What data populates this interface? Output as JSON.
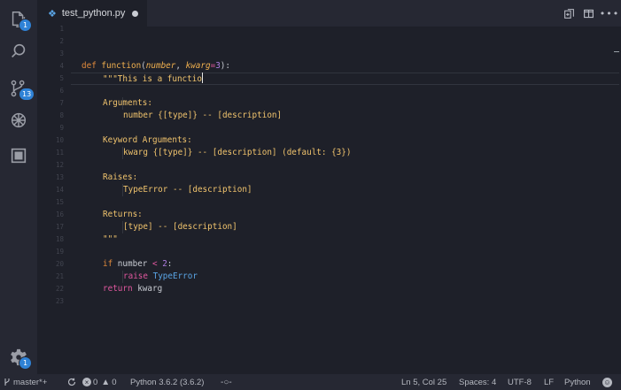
{
  "activity_bar": {
    "explorer_badge": "1",
    "scm_badge": "13",
    "settings_badge": "1"
  },
  "tab": {
    "filename": "test_python.py"
  },
  "editor": {
    "lines": [
      {
        "n": "1"
      },
      {
        "n": "2"
      },
      {
        "n": "3"
      },
      {
        "n": "4"
      },
      {
        "n": "5"
      },
      {
        "n": "6"
      },
      {
        "n": "7"
      },
      {
        "n": "8"
      },
      {
        "n": "9"
      },
      {
        "n": "10"
      },
      {
        "n": "11"
      },
      {
        "n": "12"
      },
      {
        "n": "13"
      },
      {
        "n": "14"
      },
      {
        "n": "15"
      },
      {
        "n": "16"
      },
      {
        "n": "17"
      },
      {
        "n": "18"
      },
      {
        "n": "19"
      },
      {
        "n": "20"
      },
      {
        "n": "21"
      },
      {
        "n": "22"
      },
      {
        "n": "23"
      }
    ],
    "code": {
      "l4_def": "def ",
      "l4_name": "function",
      "l4_open": "(",
      "l4_param1": "number",
      "l4_comma": ", ",
      "l4_param2": "kwarg",
      "l4_eq": "=",
      "l4_default": "3",
      "l4_close": "):",
      "l5": "\"\"\"This is a functio",
      "l7": "Arguments:",
      "l8": "number {[type]} -- [description]",
      "l10": "Keyword Arguments:",
      "l11": "kwarg {[type]} -- [description] (default: {3})",
      "l13": "Raises:",
      "l14": "TypeError -- [description]",
      "l16": "Returns:",
      "l17": "[type] -- [description]",
      "l18": "\"\"\"",
      "l20_if": "if",
      "l20_var": " number ",
      "l20_op": "<",
      "l20_num": " 2",
      "l20_colon": ":",
      "l21_raise": "raise",
      "l21_cls": " TypeError",
      "l22_return": "return",
      "l22_var": " kwarg"
    }
  },
  "statusbar": {
    "branch": "master*+",
    "errors": "0",
    "warnings": "0",
    "interpreter": "Python 3.6.2 (3.6.2)",
    "position": "Ln 5, Col 25",
    "spaces": "Spaces: 4",
    "encoding": "UTF-8",
    "eol": "LF",
    "language": "Python"
  },
  "colors": {
    "background": "#1e2029",
    "keyword": "#e08a3c",
    "docstring": "#f0c36d",
    "badge": "#2f82d6"
  }
}
